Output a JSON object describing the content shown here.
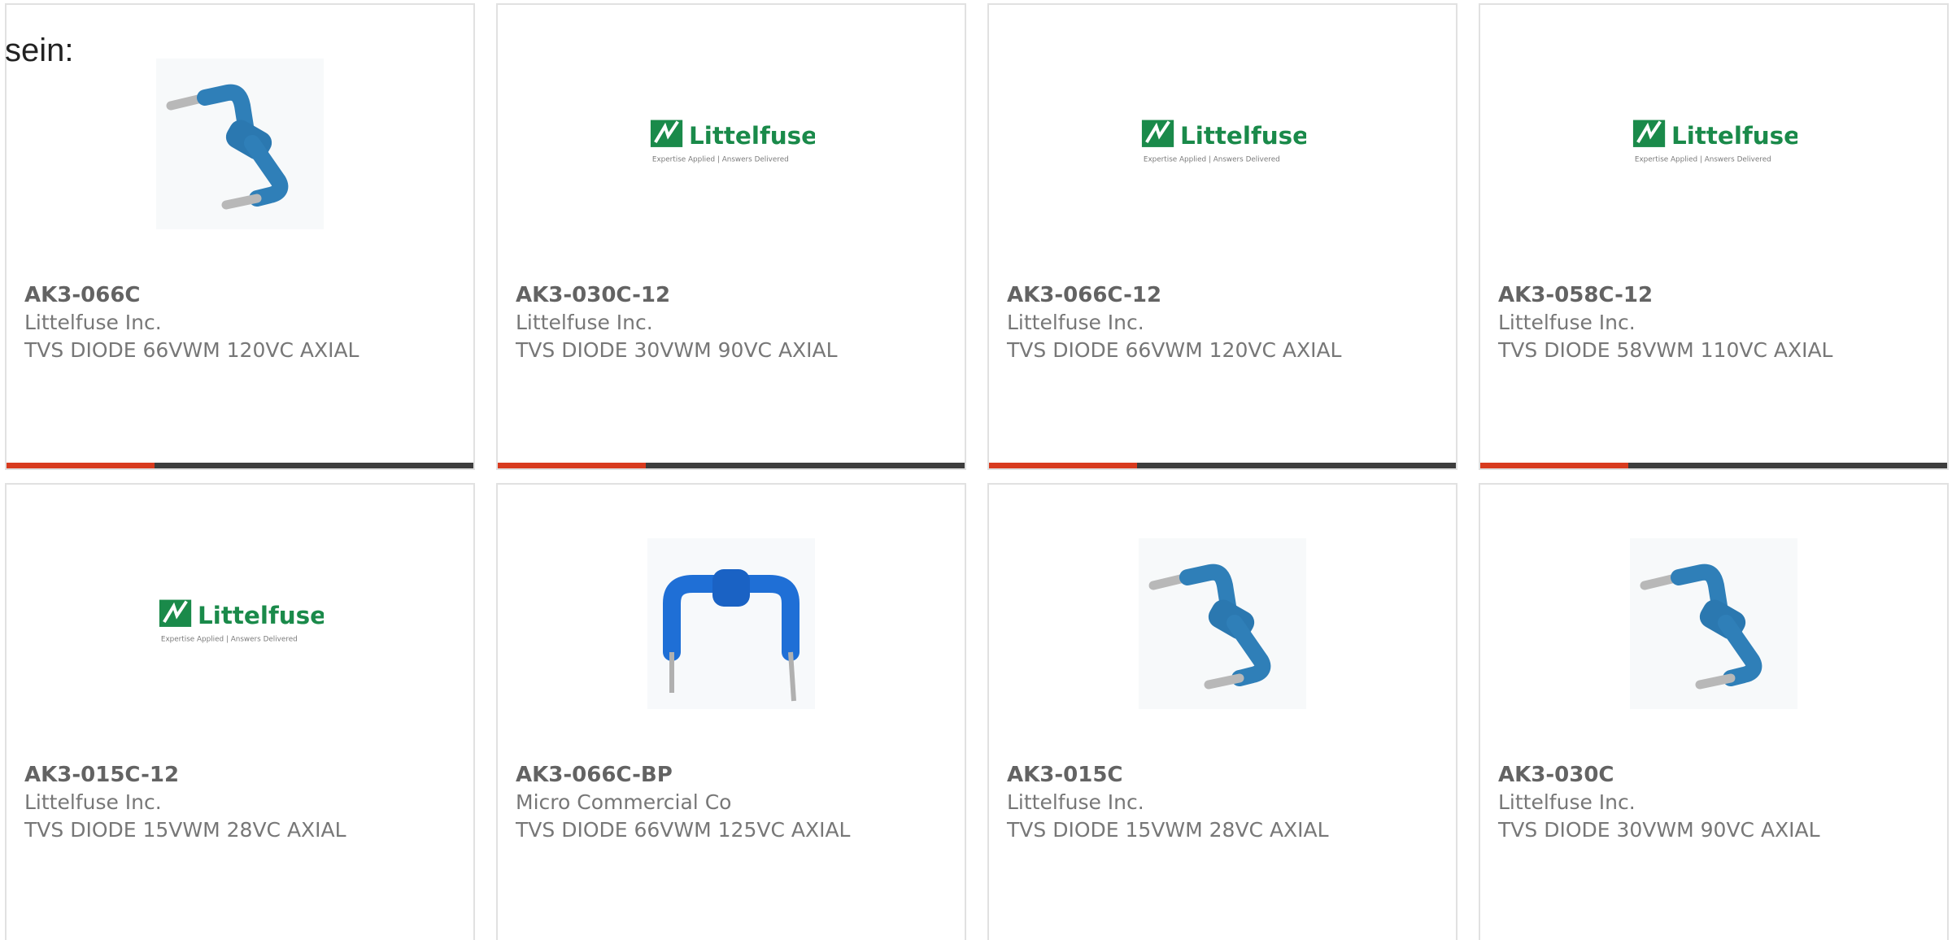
{
  "intro_text": "sein:",
  "colors": {
    "accent_bar": "#d83b1f",
    "dark_bar": "#3d3d3d",
    "card_border": "#e1e1e1",
    "logo_green": "#1a8a4a",
    "diode_blue": "#2f7fb8",
    "diode_blue_bp": "#1f6fd6"
  },
  "logo": {
    "name": "Littelfuse",
    "tagline": "Expertise Applied | Answers Delivered"
  },
  "products": [
    {
      "part": "AK3-066C",
      "manufacturer": "Littelfuse Inc.",
      "description": "TVS DIODE 66VWM 120VC AXIAL",
      "image": "axial-diode-photo"
    },
    {
      "part": "AK3-030C-12",
      "manufacturer": "Littelfuse Inc.",
      "description": "TVS DIODE 30VWM 90VC AXIAL",
      "image": "littelfuse-logo"
    },
    {
      "part": "AK3-066C-12",
      "manufacturer": "Littelfuse Inc.",
      "description": "TVS DIODE 66VWM 120VC AXIAL",
      "image": "littelfuse-logo"
    },
    {
      "part": "AK3-058C-12",
      "manufacturer": "Littelfuse Inc.",
      "description": "TVS DIODE 58VWM 110VC AXIAL",
      "image": "littelfuse-logo"
    },
    {
      "part": "AK3-015C-12",
      "manufacturer": "Littelfuse Inc.",
      "description": "TVS DIODE 15VWM 28VC AXIAL",
      "image": "littelfuse-logo"
    },
    {
      "part": "AK3-066C-BP",
      "manufacturer": "Micro Commercial Co",
      "description": "TVS DIODE 66VWM 125VC AXIAL",
      "image": "radial-diode-photo"
    },
    {
      "part": "AK3-015C",
      "manufacturer": "Littelfuse Inc.",
      "description": "TVS DIODE 15VWM 28VC AXIAL",
      "image": "axial-diode-photo"
    },
    {
      "part": "AK3-030C",
      "manufacturer": "Littelfuse Inc.",
      "description": "TVS DIODE 30VWM 90VC AXIAL",
      "image": "axial-diode-photo"
    }
  ]
}
